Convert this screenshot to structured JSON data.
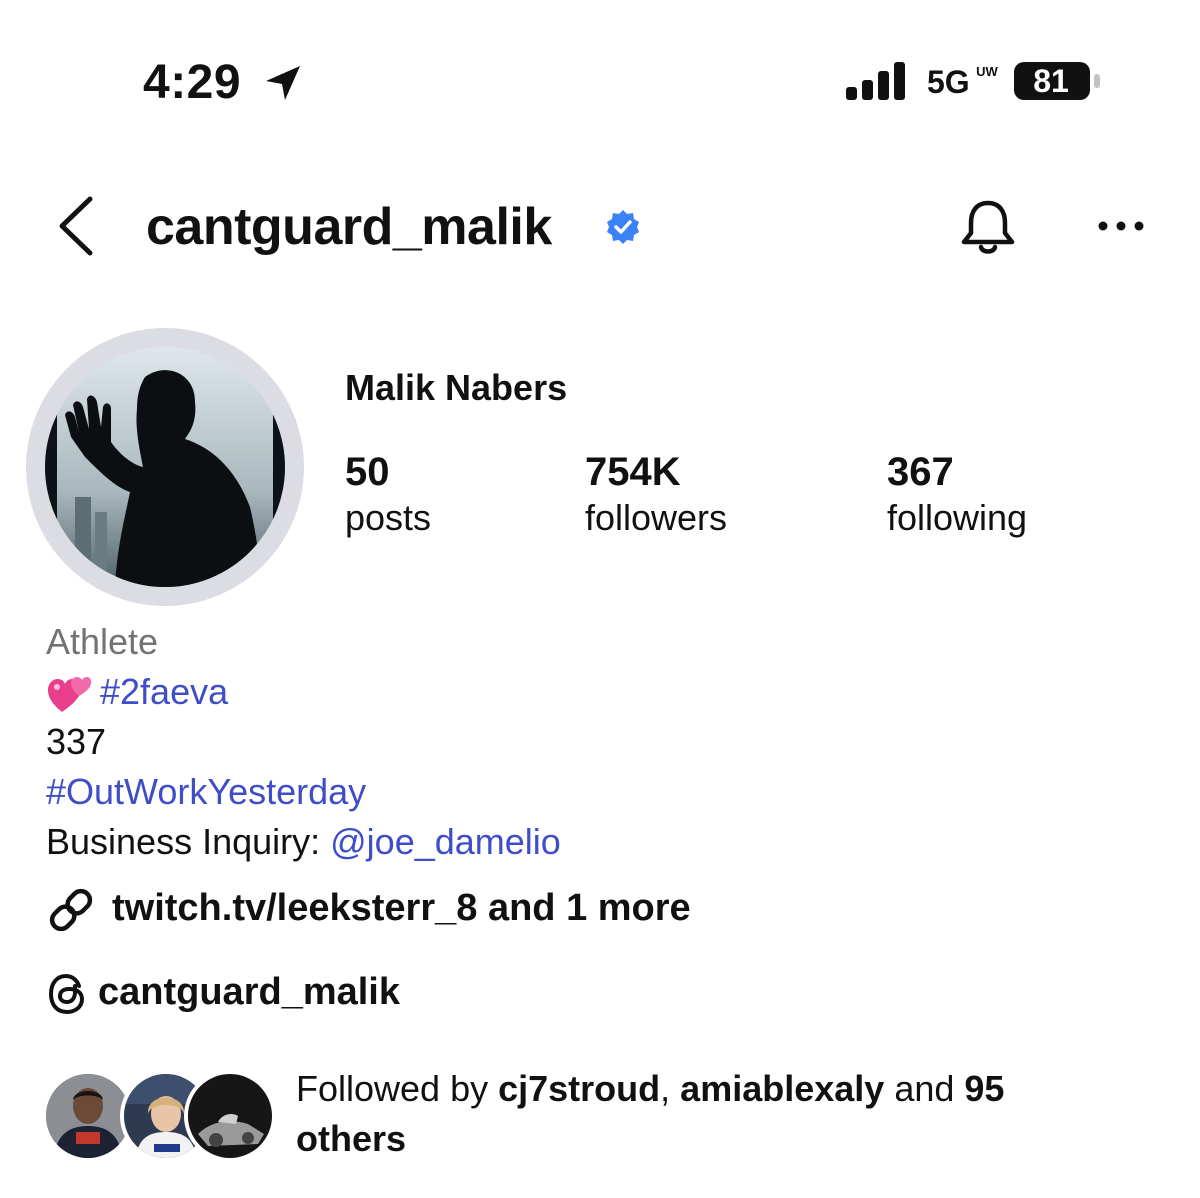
{
  "status_bar": {
    "time": "4:29",
    "network": "5G",
    "network_superscript": "UW",
    "battery": "81",
    "location_icon": "location-arrow-icon",
    "signal_icon": "cellular-signal-icon"
  },
  "header": {
    "username": "cantguard_malik",
    "back_icon": "chevron-left-icon",
    "verified_icon": "verified-badge-icon",
    "bell_icon": "bell-icon",
    "more_icon": "more-horizontal-icon",
    "verified_color": "#3b82f6"
  },
  "profile": {
    "full_name": "Malik Nabers",
    "stats": [
      {
        "value": "50",
        "label": "posts"
      },
      {
        "value": "754K",
        "label": "followers"
      },
      {
        "value": "367",
        "label": "following"
      }
    ]
  },
  "bio": {
    "category": "Athlete",
    "heart_icon": "two-hearts-emoji-icon",
    "hashtag_1": "#2faeva",
    "line_3": "337",
    "hashtag_2": "#OutWorkYesterday",
    "business_label": "Business Inquiry: ",
    "business_handle": "@joe_damelio",
    "link_color": "#3f4ec8"
  },
  "links": {
    "link_icon": "link-icon",
    "link_text": "twitch.tv/leeksterr_8 and 1 more",
    "threads_icon": "threads-icon",
    "threads_handle": "cantguard_malik"
  },
  "followed_by": {
    "prefix": "Followed by ",
    "user_1": "cj7stroud",
    "separator": ", ",
    "user_2": "amiablexaly",
    "middle": " and ",
    "count": "95",
    "suffix": "others"
  }
}
